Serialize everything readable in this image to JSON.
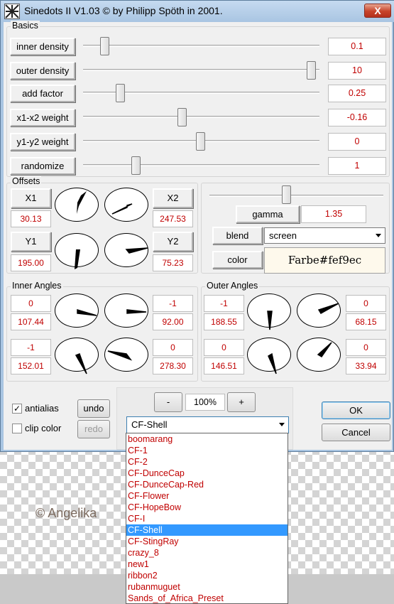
{
  "window": {
    "title": "Sinedots II V1.03 © by Philipp Spöth in 2001.",
    "close_label": "X"
  },
  "basics": {
    "label": "Basics",
    "rows": [
      {
        "label": "inner density",
        "value": "0.1",
        "slider": 0.07
      },
      {
        "label": "outer density",
        "value": "10",
        "slider": 1.0
      },
      {
        "label": "add factor",
        "value": "0.25",
        "slider": 0.14
      },
      {
        "label": "x1-x2 weight",
        "value": "-0.16",
        "slider": 0.42
      },
      {
        "label": "y1-y2 weight",
        "value": "0",
        "slider": 0.5
      },
      {
        "label": "randomize",
        "value": "1",
        "slider": 0.21
      }
    ]
  },
  "offsets": {
    "label": "Offsets",
    "x1": {
      "label": "X1",
      "value": "30.13"
    },
    "x2": {
      "label": "X2",
      "value": "247.53"
    },
    "y1": {
      "label": "Y1",
      "value": "195.00"
    },
    "y2": {
      "label": "Y2",
      "value": "75.23"
    }
  },
  "gamma": {
    "label": "gamma",
    "value": "1.35",
    "slider": 0.46
  },
  "blend": {
    "label": "blend",
    "selected": "screen"
  },
  "color": {
    "label": "color",
    "value": "Farbe#fef9ec",
    "swatch": "#fef9ec"
  },
  "inner_angles": {
    "label": "Inner Angles",
    "a": {
      "top": "0",
      "bottom": "107.44"
    },
    "b": {
      "top": "-1",
      "bottom": "92.00"
    },
    "c": {
      "top": "-1",
      "bottom": "152.01"
    },
    "d": {
      "top": "0",
      "bottom": "278.30"
    }
  },
  "outer_angles": {
    "label": "Outer Angles",
    "a": {
      "top": "-1",
      "bottom": "188.55"
    },
    "b": {
      "top": "0",
      "bottom": "68.15"
    },
    "c": {
      "top": "0",
      "bottom": "146.51"
    },
    "d": {
      "top": "0",
      "bottom": "33.94"
    }
  },
  "options": {
    "antialias": "antialias",
    "antialias_checked": "✓",
    "clip_color": "clip color",
    "undo": "undo",
    "redo": "redo"
  },
  "zoom": {
    "minus": "-",
    "value": "100%",
    "plus": "+"
  },
  "preset": {
    "selected": "CF-Shell",
    "items": [
      "boomarang",
      "CF-1",
      "CF-2",
      "CF-DunceCap",
      "CF-DunceCap-Red",
      "CF-Flower",
      "CF-HopeBow",
      "CF-I",
      "CF-Shell",
      "CF-StingRay",
      "crazy_8",
      "new1",
      "ribbon2",
      "rubanmuguet",
      "Sands_of_Africa_Preset"
    ],
    "selected_index": 8
  },
  "actions": {
    "ok": "OK",
    "cancel": "Cancel"
  },
  "watermark": "© Angelika",
  "colors": {
    "value_text": "#c00000",
    "selection": "#3399ff",
    "title_bg": "#a9c5e2"
  }
}
